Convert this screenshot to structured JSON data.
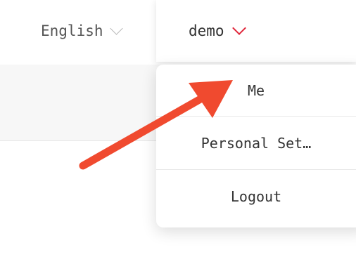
{
  "header": {
    "language": {
      "label": "English",
      "chevron_icon": "chevron-down-icon"
    },
    "user": {
      "name": "demo",
      "chevron_icon": "chevron-down-icon",
      "chevron_color": "#e0263a"
    }
  },
  "user_menu": {
    "items": [
      {
        "label": "Me"
      },
      {
        "label": "Personal Set…"
      },
      {
        "label": "Logout"
      }
    ]
  },
  "annotation": {
    "arrow_color": "#f04a2f"
  }
}
